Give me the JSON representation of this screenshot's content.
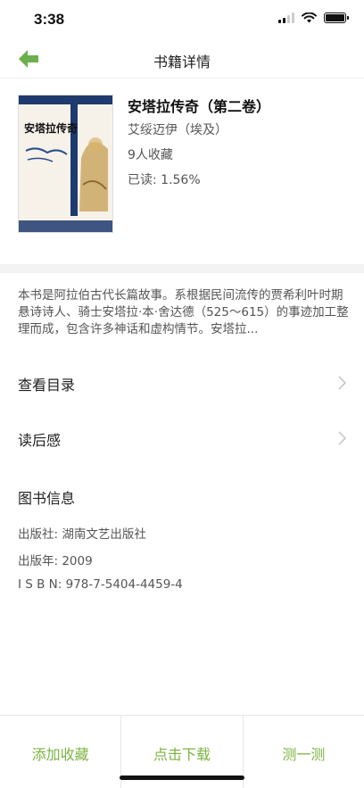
{
  "status_bar": {
    "time": "3:38"
  },
  "nav": {
    "title": "书籍详情",
    "back_icon": "back-arrow-icon",
    "accent": "#6ab04c"
  },
  "book": {
    "title": "安塔拉传奇（第二卷）",
    "author": "艾绥迈伊（埃及）",
    "favorites": "9人收藏",
    "read_progress": "已读: 1.56%",
    "cover_title": "安塔拉传奇"
  },
  "description": "本书是阿拉伯古代长篇故事。系根据民间流传的贾希利叶时期悬诗诗人、骑士安塔拉·本·舍达德（525～615）的事迹加工整理而成，包含许多神话和虚构情节。安塔拉...",
  "rows": [
    {
      "label": "查看目录"
    },
    {
      "label": "读后感"
    }
  ],
  "info": {
    "title": "图书信息",
    "publisher": "出版社: 湖南文艺出版社",
    "year": "出版年: 2009",
    "isbn": "I S B N: 978-7-5404-4459-4"
  },
  "bottom": {
    "favorite": "添加收藏",
    "download": "点击下载",
    "quiz": "测一测",
    "accent": "#7cb342"
  }
}
